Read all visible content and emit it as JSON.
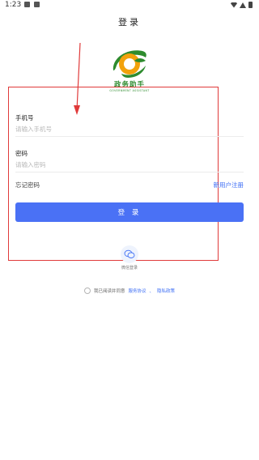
{
  "status_bar": {
    "time": "1:23"
  },
  "page": {
    "title": "登录"
  },
  "logo": {
    "name": "政务助手",
    "subtitle": "GOVERNMENT ASSISTANT"
  },
  "form": {
    "phone_label": "手机号",
    "phone_placeholder": "请输入手机号",
    "password_label": "密码",
    "password_placeholder": "请输入密码",
    "forgot_password": "忘记密码",
    "register": "新用户注册",
    "login_button": "登 录"
  },
  "alt_login": {
    "wechat_label": "微信登录"
  },
  "agreement": {
    "text": "我已阅读并同意",
    "service_link": "服务协议",
    "separator": "、",
    "privacy_link": "隐私政策"
  },
  "colors": {
    "accent": "#4a71f5",
    "link": "#3d6ef5",
    "logo_green": "#2e8b2e",
    "logo_orange": "#f2a20c",
    "annotation_red": "#e03a3a"
  },
  "icons": [
    "image-icon",
    "notification-icon",
    "wifi-icon",
    "signal-icon",
    "battery-icon",
    "wechat-icon"
  ]
}
